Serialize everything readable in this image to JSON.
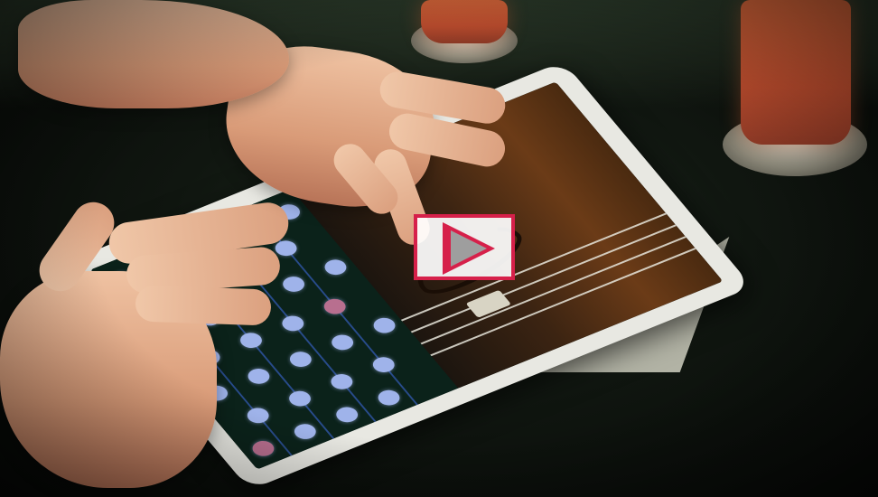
{
  "video": {
    "play_label": "",
    "play_icon": "play-icon",
    "accent_color": "#d6204a"
  },
  "scene": {
    "tablet_color": "#e8e8e2",
    "key_color": "#9fb3ea",
    "active_key_color": "#b86f8f",
    "candle_color": "#e06a3c"
  }
}
